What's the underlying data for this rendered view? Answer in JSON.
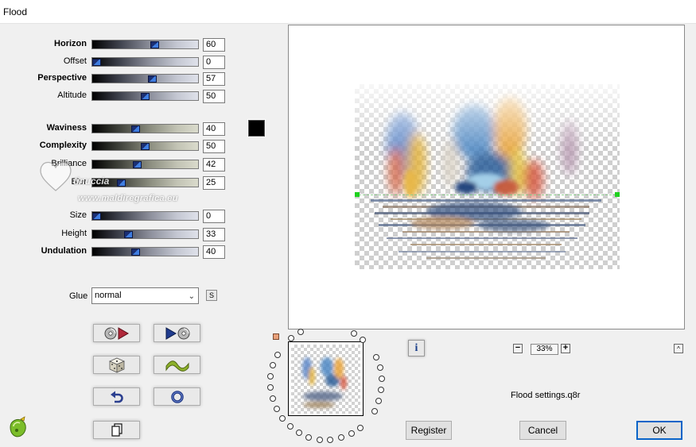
{
  "window": {
    "title": "Flood"
  },
  "sliders": [
    {
      "label": "Horizon",
      "value": "60",
      "bold": true,
      "style": "gray",
      "level": 0.6
    },
    {
      "label": "Offset",
      "value": "0",
      "bold": false,
      "style": "gray",
      "level": 0.0
    },
    {
      "label": "Perspective",
      "value": "57",
      "bold": true,
      "style": "gray",
      "level": 0.57
    },
    {
      "label": "Altitude",
      "value": "50",
      "bold": false,
      "style": "gray",
      "level": 0.5
    },
    {
      "label": "Waviness",
      "value": "40",
      "bold": true,
      "style": "beige",
      "level": 0.4
    },
    {
      "label": "Complexity",
      "value": "50",
      "bold": true,
      "style": "beige",
      "level": 0.5
    },
    {
      "label": "Brilliance",
      "value": "42",
      "bold": false,
      "style": "beige",
      "level": 0.42
    },
    {
      "label": "Blur",
      "value": "25",
      "bold": false,
      "style": "beige",
      "level": 0.25
    },
    {
      "label": "Size",
      "value": "0",
      "bold": false,
      "style": "gray",
      "level": 0.0
    },
    {
      "label": "Height",
      "value": "33",
      "bold": false,
      "style": "gray",
      "level": 0.33
    },
    {
      "label": "Undulation",
      "value": "40",
      "bold": true,
      "style": "gray",
      "level": 0.4
    }
  ],
  "color_swatch": {
    "color": "#000000"
  },
  "glue": {
    "label": "Glue",
    "value": "normal",
    "s_label": "S"
  },
  "tool_buttons": [
    {
      "name": "load-preset-button",
      "icon": "disc-play-icon"
    },
    {
      "name": "save-preset-button",
      "icon": "play-disc-icon"
    },
    {
      "name": "randomize-button",
      "icon": "dice-icon"
    },
    {
      "name": "wave-button",
      "icon": "wave-icon"
    },
    {
      "name": "undo-button",
      "icon": "undo-arrow-icon"
    },
    {
      "name": "reset-button",
      "icon": "ring-icon"
    },
    {
      "name": "copy-button",
      "icon": "copy-pages-icon"
    }
  ],
  "zoom": {
    "value": "33%",
    "minus": "−",
    "plus": "+"
  },
  "info_label": "i",
  "up_label": "^",
  "settings_file": "Flood settings.q8r",
  "buttons": {
    "register": "Register",
    "cancel": "Cancel",
    "ok": "OK"
  },
  "watermark": {
    "line1": "tinuccia",
    "line2": "www.maldiregrafica.eu"
  }
}
